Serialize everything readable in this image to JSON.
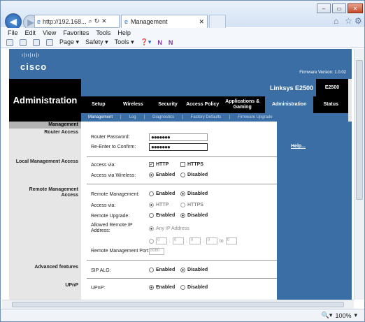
{
  "browser": {
    "address": "http://192.168...",
    "tab_title": "Management",
    "menu": [
      "File",
      "Edit",
      "View",
      "Favorites",
      "Tools",
      "Help"
    ],
    "commands": [
      "Page",
      "Safety",
      "Tools"
    ],
    "zoom": "100%",
    "win_controls": [
      "minimize",
      "maximize",
      "close"
    ]
  },
  "page": {
    "brand": "cisco",
    "firmware": "Firmware Version: 1.0.02",
    "section_title": "Administration",
    "model_name": "Linksys E2500",
    "model_code": "E2500",
    "nav": [
      "Setup",
      "Wireless",
      "Security",
      "Access Policy",
      "Applications & Gaming",
      "Administration",
      "Status"
    ],
    "subnav": [
      "Management",
      "Log",
      "Diagnostics",
      "Factory Defaults",
      "Firmware Upgrade"
    ],
    "left_header": "Management",
    "labels": {
      "router_access": "Router Access",
      "local_mgmt": "Local Management Access",
      "remote_mgmt": "Remote Management Access",
      "advanced": "Advanced features",
      "upnp": "UPnP"
    },
    "help": "Help...",
    "form": {
      "router_password": "Router Password:",
      "reenter": "Re-Enter to  Confirm:",
      "pw_value": "●●●●●●●",
      "access_via": "Access via:",
      "http": "HTTP",
      "https": "HTTPS",
      "access_wireless": "Access via Wireless:",
      "enabled": "Enabled",
      "disabled": "Disabled",
      "remote_management": "Remote  Management:",
      "remote_upgrade": "Remote Upgrade:",
      "allowed_ip": "Allowed Remote IP Address:",
      "any_ip": "Any IP Address",
      "ip_fields": [
        "0",
        "0",
        "0",
        "0",
        "0"
      ],
      "to": "to",
      "remote_port": "Remote Management Port:",
      "port_value": "8080",
      "sip_alg": "SIP ALG:",
      "upnp": "UPnP:"
    }
  }
}
